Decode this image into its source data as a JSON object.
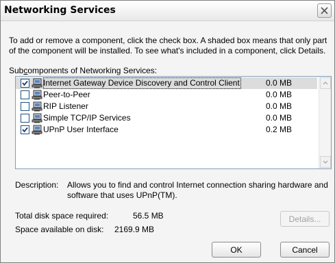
{
  "window": {
    "title": "Networking Services"
  },
  "instructions": "To add or remove a component, click the check box. A shaded box means that only part of the component will be installed. To see what's included in a component, click Details.",
  "subcomponents": {
    "label_prefix": "Sub",
    "label_mnemonic": "c",
    "label_rest": "omponents of Networking Services:",
    "items": [
      {
        "label": "Internet Gateway Device Discovery and Control Client",
        "size": "0.0 MB",
        "checked": true,
        "selected": true
      },
      {
        "label": "Peer-to-Peer",
        "size": "0.0 MB",
        "checked": false,
        "selected": false
      },
      {
        "label": "RIP Listener",
        "size": "0.0 MB",
        "checked": false,
        "selected": false
      },
      {
        "label": "Simple TCP/IP Services",
        "size": "0.0 MB",
        "checked": false,
        "selected": false
      },
      {
        "label": "UPnP User Interface",
        "size": "0.2 MB",
        "checked": true,
        "selected": false
      }
    ]
  },
  "description": {
    "label": "Description:",
    "text": "Allows you to find and control Internet connection sharing hardware and software that uses UPnP(TM)."
  },
  "disk": {
    "required_label": "Total disk space required:",
    "required_value": "56.5 MB",
    "available_label": "Space available on disk:",
    "available_value": "2169.9 MB"
  },
  "buttons": {
    "details": "Details...",
    "ok": "OK",
    "cancel": "Cancel"
  },
  "icons": {
    "close": "close-icon",
    "network": "network-computer-icon",
    "check": "checkmark-icon"
  },
  "colors": {
    "listbox_border": "#7f9db9",
    "checkbox_border": "#1c5180",
    "selection": "#dcdcdc"
  }
}
